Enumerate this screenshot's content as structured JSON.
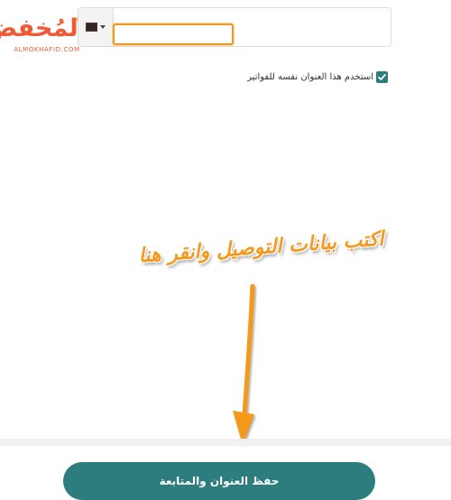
{
  "logo": {
    "brand_text": "المُخفض",
    "subtext": "ALMOKHAFID.COM",
    "brand_color": "#ef5a34"
  },
  "phone": {
    "country_flag_icon": "flag-icon",
    "caret_icon": "chevron-down-icon",
    "value": "",
    "highlight_color": "#f39a1e"
  },
  "billing": {
    "label": "استخدم هذا العنوان نفسه للفواتير",
    "checked": true,
    "check_color": "#2e7d7e"
  },
  "annotation": {
    "text": "اكتب بيانات التوصيل وانقر هنا",
    "color": "#f39a1e"
  },
  "footer": {
    "submit_label": "حفظ العنوان والمتابعة",
    "button_color": "#2e7d7e"
  }
}
